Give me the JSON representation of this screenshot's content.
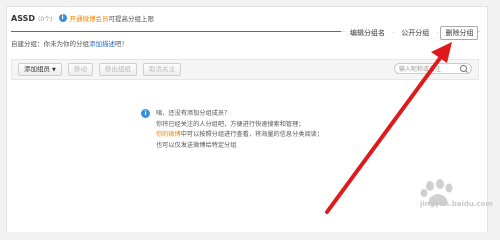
{
  "header": {
    "group_name": "ASSD",
    "group_count": "(0个)",
    "note_accent": "开通微博会员",
    "note_rest": "可提高分组上限"
  },
  "actions": {
    "edit": "编辑分组名",
    "public": "公开分组",
    "delete": "删除分组",
    "separator": "·"
  },
  "setting": {
    "prefix": "自建分组：你未为你的分组",
    "link": "添加描述",
    "suffix": "吧！"
  },
  "toolbar": {
    "add_member": "添加组员",
    "caret": "▼",
    "move": "移动",
    "remove": "移出组组",
    "unfollow": "取消关注",
    "search_placeholder": "输入昵称或备注"
  },
  "empty_state": {
    "line1": "咦，还没有添加分组成员？",
    "line2": "你将已经关注的人分组吧，方便进行快速搜索和管理；",
    "line3_accent": "你的微博",
    "line3_rest": "中可以按照分组进行查看，将海量的信息分类阅读；",
    "line4": "也可以仅发送微博给特定分组"
  },
  "colors": {
    "accent_red": "#e33333",
    "orange": "#f08300",
    "link_blue": "#2b67c5",
    "arrow_red": "#e0191c"
  },
  "watermark": {
    "text": "jingyan.baidu.com"
  }
}
